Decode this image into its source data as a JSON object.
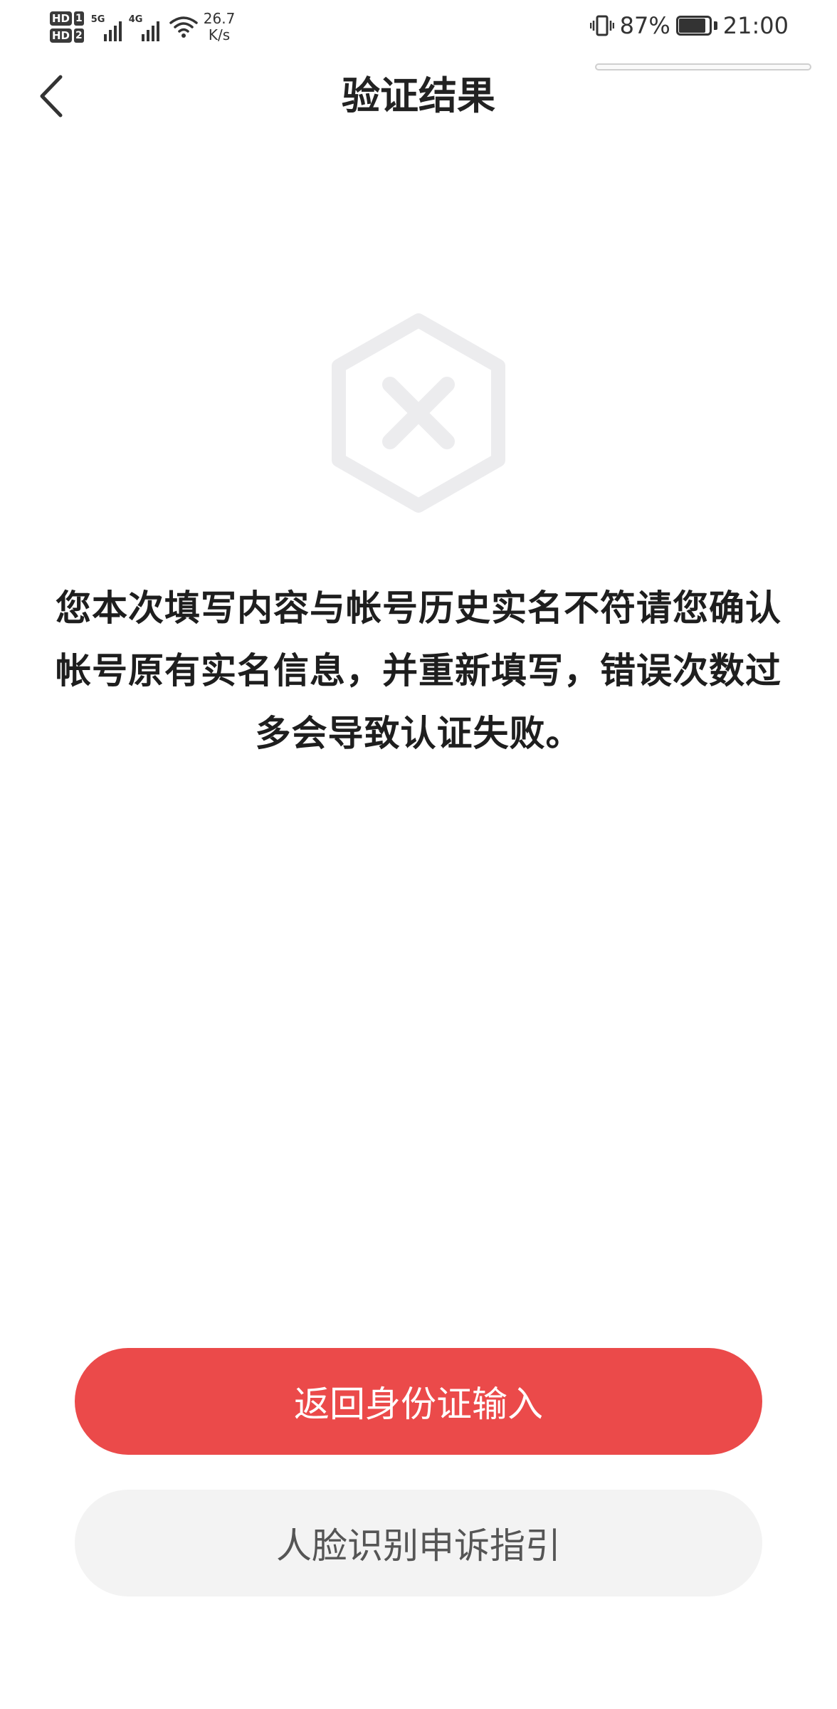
{
  "status_bar": {
    "sim1_label": "HD",
    "sim1_slot": "1",
    "sim2_label": "HD",
    "sim2_slot": "2",
    "network1": "5G",
    "network2": "4G",
    "speed_value": "26.7",
    "speed_unit": "K/s",
    "battery_percent": "87%",
    "battery_level": 0.87,
    "time": "21:00",
    "icons": [
      "hd-badge",
      "signal-bars",
      "wifi-icon",
      "vibrate-icon",
      "battery-icon"
    ]
  },
  "header": {
    "title": "验证结果",
    "back_icon": "chevron-left-icon"
  },
  "result": {
    "icon": "failure-hexagon-x-icon",
    "message": "您本次填写内容与帐号历史实名不符请您确认帐号原有实名信息，并重新填写，错误次数过多会导致认证失败。"
  },
  "actions": {
    "primary_label": "返回身份证输入",
    "secondary_label": "人脸识别申诉指引"
  },
  "colors": {
    "primary": "#eb4a4a",
    "secondary_bg": "#f3f3f3",
    "icon_gray": "#ececee"
  }
}
